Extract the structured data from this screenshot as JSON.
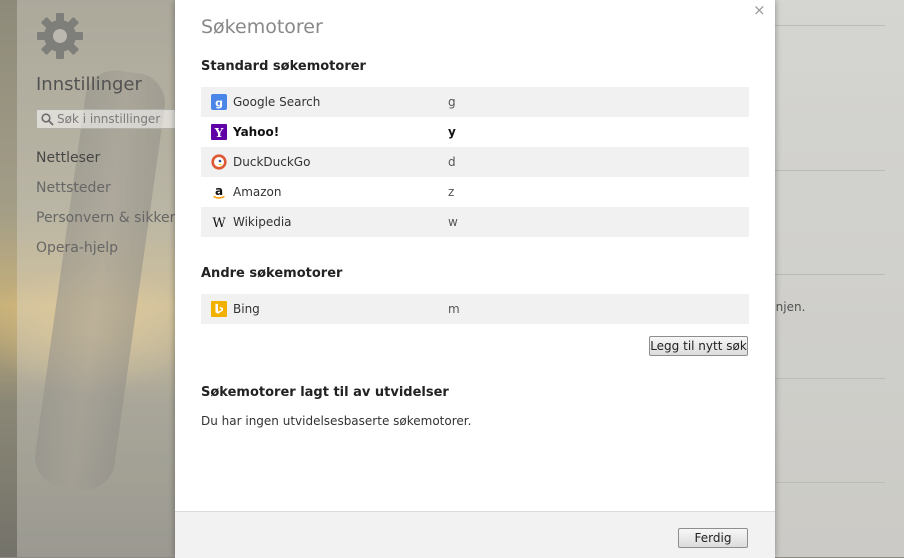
{
  "sidebar": {
    "title": "Innstillinger",
    "search_placeholder": "Søk i innstillinger",
    "nav": [
      "Nettleser",
      "Nettsteder",
      "Personvern & sikkerhet",
      "Opera-hjelp"
    ]
  },
  "background": {
    "right_text": "linjen."
  },
  "dialog": {
    "title": "Søkemotorer",
    "close_label": "×",
    "standard_heading": "Standard søkemotorer",
    "standard_engines": [
      {
        "name": "Google Search",
        "keyword": "g",
        "icon": "google-icon"
      },
      {
        "name": "Yahoo!",
        "keyword": "y",
        "icon": "yahoo-icon",
        "default": true
      },
      {
        "name": "DuckDuckGo",
        "keyword": "d",
        "icon": "duckduckgo-icon"
      },
      {
        "name": "Amazon",
        "keyword": "z",
        "icon": "amazon-icon"
      },
      {
        "name": "Wikipedia",
        "keyword": "w",
        "icon": "wikipedia-icon"
      }
    ],
    "other_heading": "Andre søkemotorer",
    "other_engines": [
      {
        "name": "Bing",
        "keyword": "m",
        "icon": "bing-icon"
      }
    ],
    "add_button": "Legg til nytt søk",
    "extensions_heading": "Søkemotorer lagt til av utvidelser",
    "extensions_note": "Du har ingen utvidelsesbaserte søkemotorer.",
    "done_button": "Ferdig"
  },
  "colors": {
    "google": "#4a86e8",
    "yahoo": "#5f01a6",
    "bing": "#f2b100",
    "duckduckgo": "#de5833"
  }
}
